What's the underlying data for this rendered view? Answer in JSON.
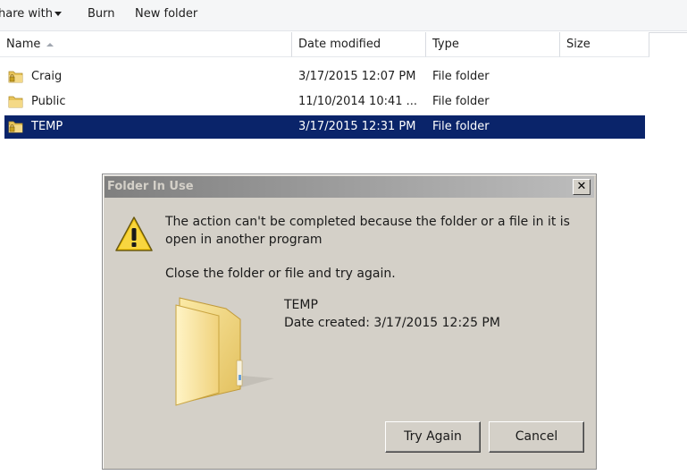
{
  "toolbar": {
    "share_label": "hare with",
    "burn_label": "Burn",
    "new_folder_label": "New folder"
  },
  "columns": {
    "name": "Name",
    "date_modified": "Date modified",
    "type": "Type",
    "size": "Size"
  },
  "files": [
    {
      "name": "Craig",
      "date": "3/17/2015 12:07 PM",
      "type": "File folder",
      "icon": "locked-folder-icon",
      "selected": false
    },
    {
      "name": "Public",
      "date": "11/10/2014 10:41 ...",
      "type": "File folder",
      "icon": "folder-icon",
      "selected": false
    },
    {
      "name": "TEMP",
      "date": "3/17/2015 12:31 PM",
      "type": "File folder",
      "icon": "locked-folder-icon",
      "selected": true
    }
  ],
  "dialog": {
    "title": "Folder In Use",
    "close_glyph": "✕",
    "message": "The action can't be completed because the folder or a file in it is open in another program",
    "hint": "Close the folder or file and try again.",
    "item_name": "TEMP",
    "item_date": "Date created: 3/17/2015 12:25 PM",
    "try_again_label": "Try Again",
    "cancel_label": "Cancel",
    "icon": "warning-icon"
  },
  "colors": {
    "selection": "#0a246a",
    "dialog_bg": "#d4d0c8",
    "folder_yellow": "#f0d878"
  }
}
